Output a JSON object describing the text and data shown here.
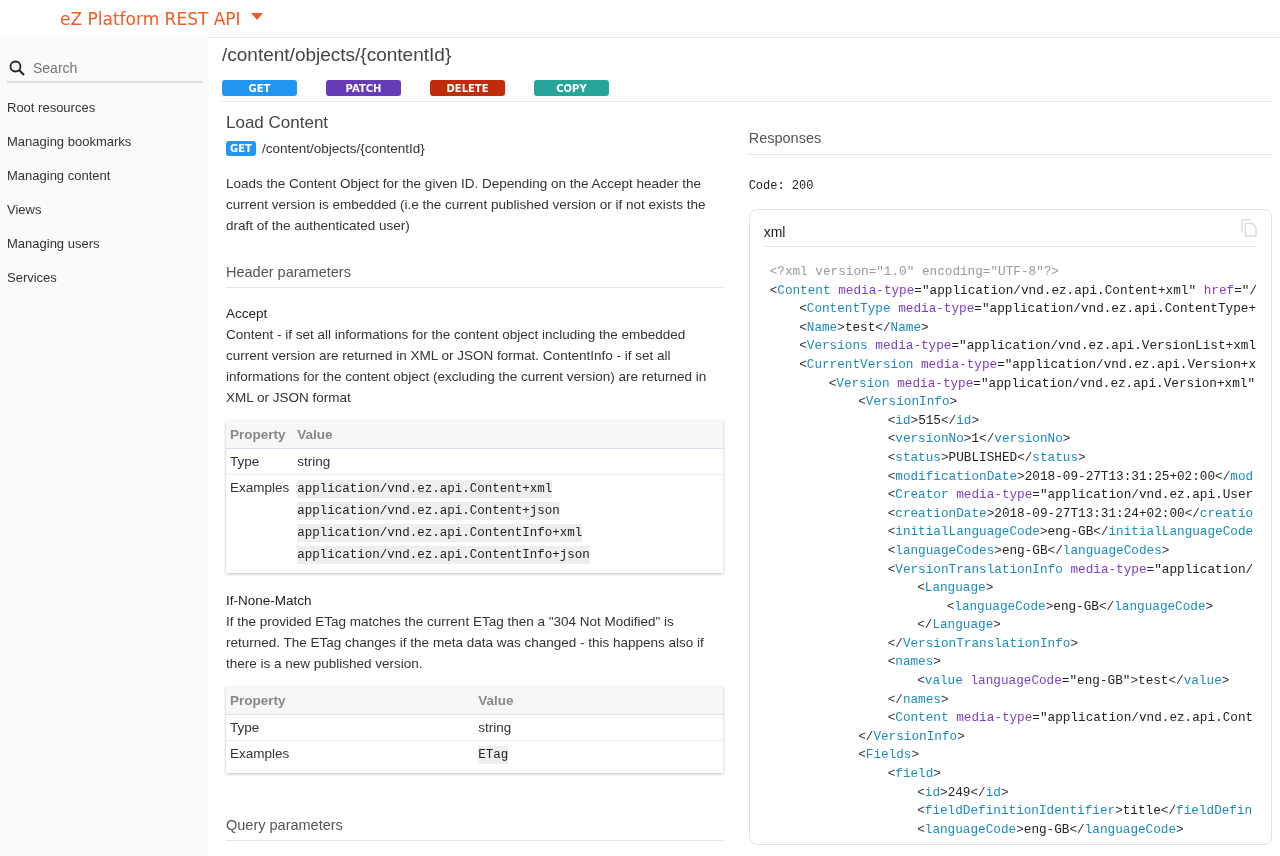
{
  "header": {
    "title": "eZ Platform REST API"
  },
  "sidebar": {
    "search": {
      "placeholder": "Search"
    },
    "items": [
      {
        "label": "Root resources"
      },
      {
        "label": "Managing bookmarks"
      },
      {
        "label": "Managing content"
      },
      {
        "label": "Views"
      },
      {
        "label": "Managing users"
      },
      {
        "label": "Services"
      }
    ]
  },
  "resource": {
    "path": "/content/objects/{contentId}",
    "methods": [
      {
        "label": "GET",
        "color": "#2196f3"
      },
      {
        "label": "PATCH",
        "color": "#673ab7"
      },
      {
        "label": "DELETE",
        "color": "#bf2c0c"
      },
      {
        "label": "COPY",
        "color": "#26a69a"
      }
    ]
  },
  "operation": {
    "title": "Load Content",
    "method": {
      "label": "GET",
      "color": "#2196f3"
    },
    "path": "/content/objects/{contentId}",
    "description": "Loads the Content Object for the given ID. Depending on the Accept header the current version is embedded (i.e the current published version or if not exists the draft of the authenticated user)",
    "header_parameters": {
      "title": "Header parameters",
      "params": [
        {
          "name": "Accept",
          "description": "Content - if set all informations for the content object including the embedded current version are returned in XML or JSON format. ContentInfo - if set all informations for the content object (excluding the current version) are returned in XML or JSON format",
          "table": {
            "columns": [
              "Property",
              "Value"
            ],
            "rows": [
              {
                "property": "Type",
                "values": [
                  "string"
                ],
                "kind": "text"
              },
              {
                "property": "Examples",
                "values": [
                  "application/vnd.ez.api.Content+xml",
                  "application/vnd.ez.api.Content+json",
                  "application/vnd.ez.api.ContentInfo+xml",
                  "application/vnd.ez.api.ContentInfo+json"
                ],
                "kind": "code"
              }
            ]
          }
        },
        {
          "name": "If-None-Match",
          "description": "If the provided ETag matches the current ETag then a \"304 Not Modified\" is returned. The ETag changes if the meta data was changed - this happens also if there is a new published version.",
          "table": {
            "columns": [
              "Property",
              "Value"
            ],
            "rows": [
              {
                "property": "Type",
                "values": [
                  "string"
                ],
                "kind": "text"
              },
              {
                "property": "Examples",
                "values": [
                  "ETag"
                ],
                "kind": "code"
              }
            ]
          }
        }
      ]
    },
    "query_parameters": {
      "title": "Query parameters"
    }
  },
  "responses": {
    "title": "Responses",
    "code": "Code: 200",
    "example": {
      "format": "xml",
      "lines": [
        {
          "kind": "declaration",
          "text": "<?xml version=\"1.0\" encoding=\"UTF-8\"?>"
        },
        {
          "kind": "element",
          "text": "<Content media-type=\"application/vnd.ez.api.Content+xml\" href=\"/",
          "children": [
            {
              "kind": "element",
              "text": "<ContentType media-type=\"application/vnd.ez.api.ContentType+"
            },
            {
              "kind": "element",
              "text": "<Name>test</Name>"
            },
            {
              "kind": "element",
              "text": "<Versions media-type=\"application/vnd.ez.api.VersionList+xml"
            },
            {
              "kind": "element",
              "text": "<CurrentVersion media-type=\"application/vnd.ez.api.Version+x",
              "children": [
                {
                  "kind": "element",
                  "text": "<Version media-type=\"application/vnd.ez.api.Version+xml\"",
                  "children": [
                    {
                      "kind": "element",
                      "text": "<VersionInfo>",
                      "children": [
                        {
                          "kind": "element",
                          "text": "<id>515</id>"
                        },
                        {
                          "kind": "element",
                          "text": "<versionNo>1</versionNo>"
                        },
                        {
                          "kind": "element",
                          "text": "<status>PUBLISHED</status>"
                        },
                        {
                          "kind": "element",
                          "text": "<modificationDate>2018-09-27T13:31:25+02:00</mod"
                        },
                        {
                          "kind": "element",
                          "text": "<Creator media-type=\"application/vnd.ez.api.User"
                        },
                        {
                          "kind": "element",
                          "text": "<creationDate>2018-09-27T13:31:24+02:00</creatio"
                        },
                        {
                          "kind": "element",
                          "text": "<initialLanguageCode>eng-GB</initialLanguageCode"
                        },
                        {
                          "kind": "element",
                          "text": "<languageCodes>eng-GB</languageCodes>"
                        },
                        {
                          "kind": "element",
                          "text": "<VersionTranslationInfo media-type=\"application/",
                          "children": [
                            {
                              "kind": "element",
                              "text": "<Language>",
                              "children": [
                                {
                                  "kind": "element",
                                  "text": "<languageCode>eng-GB</languageCode>"
                                }
                              ]
                            },
                            {
                              "kind": "element",
                              "text": "</Language>"
                            }
                          ]
                        },
                        {
                          "kind": "element",
                          "text": "</VersionTranslationInfo>"
                        },
                        {
                          "kind": "element",
                          "text": "<names>",
                          "children": [
                            {
                              "kind": "element",
                              "text": "<value languageCode=\"eng-GB\">test</value>"
                            }
                          ]
                        },
                        {
                          "kind": "element",
                          "text": "</names>"
                        },
                        {
                          "kind": "element",
                          "text": "<Content media-type=\"application/vnd.ez.api.Cont"
                        }
                      ]
                    },
                    {
                      "kind": "element",
                      "text": "</VersionInfo>"
                    },
                    {
                      "kind": "element",
                      "text": "<Fields>",
                      "children": [
                        {
                          "kind": "element",
                          "text": "<field>",
                          "children": [
                            {
                              "kind": "element",
                              "text": "<id>249</id>"
                            },
                            {
                              "kind": "element",
                              "text": "<fieldDefinitionIdentifier>title</fieldDefin"
                            },
                            {
                              "kind": "element",
                              "text": "<languageCode>eng-GB</languageCode>"
                            }
                          ]
                        }
                      ]
                    }
                  ]
                }
              ]
            }
          ]
        }
      ]
    }
  }
}
